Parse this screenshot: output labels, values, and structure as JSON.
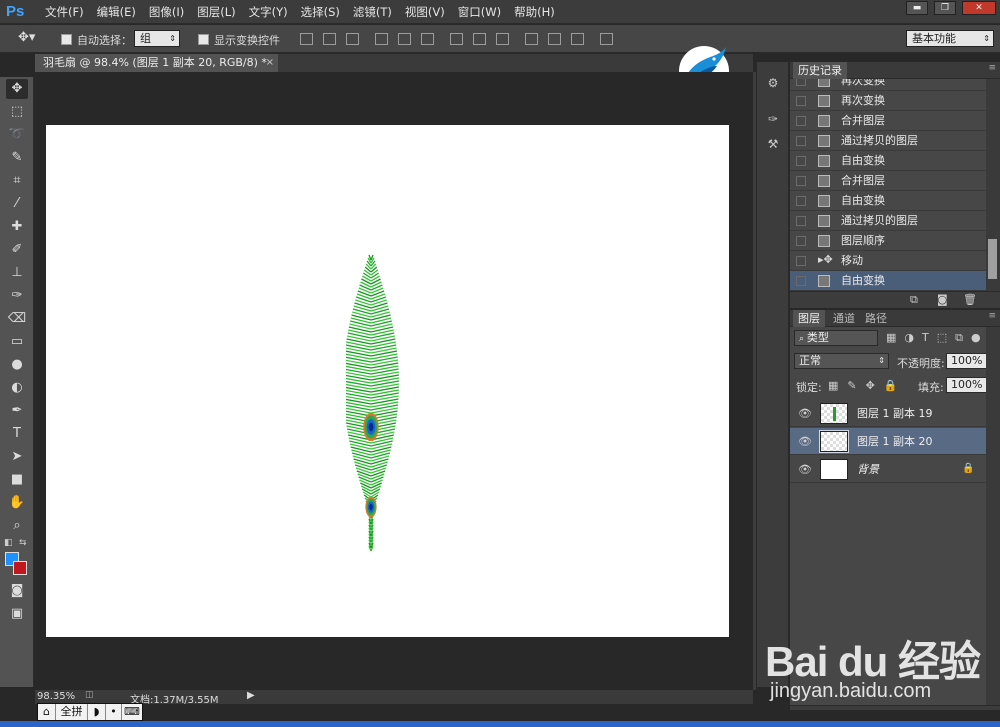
{
  "app": {
    "logo": "Ps",
    "menu": [
      "文件(F)",
      "编辑(E)",
      "图像(I)",
      "图层(L)",
      "文字(Y)",
      "选择(S)",
      "滤镜(T)",
      "视图(V)",
      "窗口(W)",
      "帮助(H)"
    ],
    "window_controls": [
      "▬",
      "❐",
      "✕"
    ]
  },
  "options_bar": {
    "auto_select_label": "自动选择：",
    "auto_select_value": "组",
    "show_transform_label": "显示变换控件",
    "workspace": "基本功能"
  },
  "document": {
    "tab_title": "羽毛扇 @ 98.4% (图层 1 副本 20, RGB/8) *",
    "tab_close": "×",
    "zoom": "98.35%",
    "doc_size": "文档:1.37M/3.55M"
  },
  "history_panel": {
    "title": "历史记录",
    "items": [
      {
        "label": "再次变换",
        "icon": "document-icon"
      },
      {
        "label": "再次变换",
        "icon": "document-icon"
      },
      {
        "label": "合并图层",
        "icon": "document-icon"
      },
      {
        "label": "通过拷贝的图层",
        "icon": "document-icon"
      },
      {
        "label": "自由变换",
        "icon": "document-icon"
      },
      {
        "label": "合并图层",
        "icon": "document-icon"
      },
      {
        "label": "自由变换",
        "icon": "document-icon"
      },
      {
        "label": "通过拷贝的图层",
        "icon": "document-icon"
      },
      {
        "label": "图层顺序",
        "icon": "document-icon"
      },
      {
        "label": "移动",
        "icon": "move-icon"
      },
      {
        "label": "自由变换",
        "icon": "document-icon"
      }
    ]
  },
  "layers_panel": {
    "tabs": [
      "图层",
      "通道",
      "路径"
    ],
    "filter_kind": "类型",
    "blend_mode": "正常",
    "opacity_label": "不透明度:",
    "opacity_value": "100%",
    "lock_label": "锁定:",
    "fill_label": "填充:",
    "fill_value": "100%",
    "layers": [
      {
        "name": "图层 1 副本 19",
        "selected": false
      },
      {
        "name": "图层 1 副本 20",
        "selected": true
      },
      {
        "name": "背景",
        "selected": false
      }
    ]
  },
  "ime_bar": {
    "mode": "全拼"
  },
  "watermark": {
    "brand": "Bai du 经验",
    "url": "jingyan.baidu.com"
  },
  "colors": {
    "foreground": "#1e90ff",
    "background": "#c0181d",
    "accent": "#4a5e7a"
  }
}
